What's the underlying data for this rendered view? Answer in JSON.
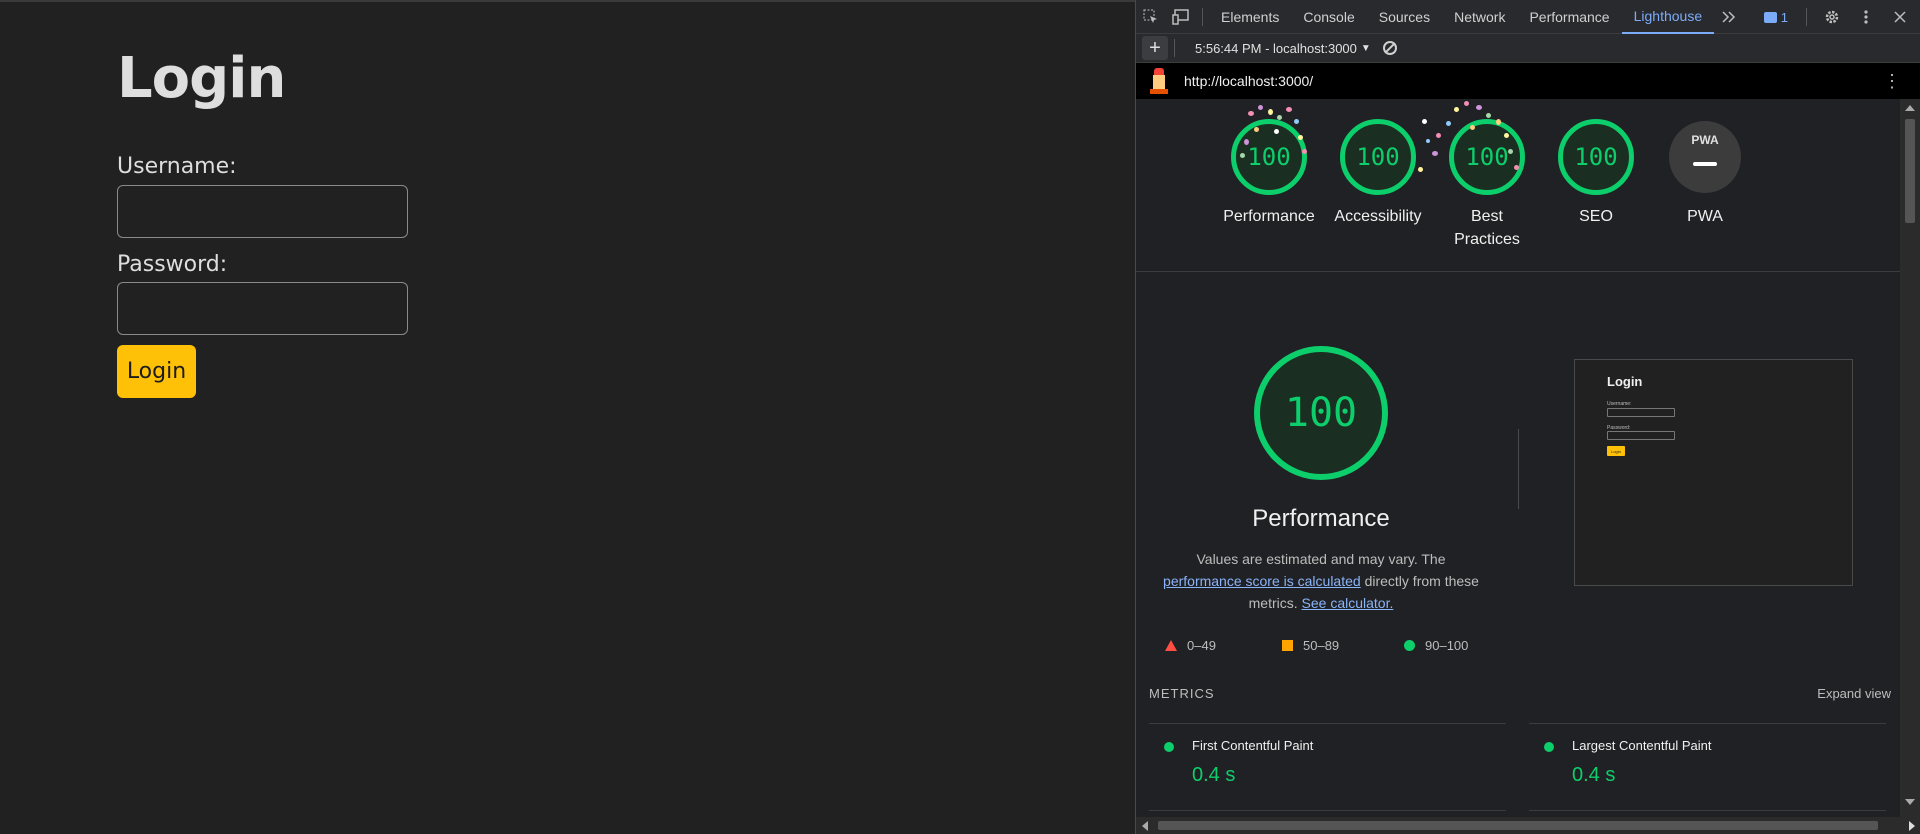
{
  "page": {
    "title": "Login",
    "username_label": "Username:",
    "password_label": "Password:",
    "username_value": "",
    "password_value": "",
    "login_button": "Login"
  },
  "devtools": {
    "tabs": [
      "Elements",
      "Console",
      "Sources",
      "Network",
      "Performance",
      "Lighthouse"
    ],
    "active_tab": "Lighthouse",
    "more_tabs_icon": "chevron-double-right-icon",
    "issues_count": "1",
    "report_selector": "5:56:44 PM - localhost:3000",
    "url": "http://localhost:3000/"
  },
  "lighthouse": {
    "categories": [
      {
        "label": "Performance",
        "score": "100"
      },
      {
        "label": "Accessibility",
        "score": "100"
      },
      {
        "label": "Best Practices",
        "score": "100"
      },
      {
        "label": "SEO",
        "score": "100"
      },
      {
        "label": "PWA",
        "score": ""
      }
    ],
    "pwa_badge": "PWA",
    "main_score": "100",
    "main_title": "Performance",
    "description_prefix": "Values are estimated and may vary. The ",
    "description_link1": "performance score is calculated",
    "description_middle": " directly from these metrics. ",
    "description_link2": "See calculator.",
    "legend": [
      {
        "shape": "triangle",
        "range": "0–49",
        "color": "#ff4e42"
      },
      {
        "shape": "square",
        "range": "50–89",
        "color": "#ffa400"
      },
      {
        "shape": "circle",
        "range": "90–100",
        "color": "#0cce6b"
      }
    ],
    "thumbnail": {
      "title": "Login",
      "username_label": "Username:",
      "password_label": "Password:",
      "button": "Login"
    },
    "metrics_heading": "METRICS",
    "expand_view": "Expand view",
    "metrics": [
      {
        "name": "First Contentful Paint",
        "value": "0.4 s"
      },
      {
        "name": "Largest Contentful Paint",
        "value": "0.4 s"
      }
    ]
  },
  "colors": {
    "pass": "#0cce6b",
    "average": "#ffa400",
    "fail": "#ff4e42",
    "accent": "#7cacf8",
    "login_button": "#ffc107"
  }
}
